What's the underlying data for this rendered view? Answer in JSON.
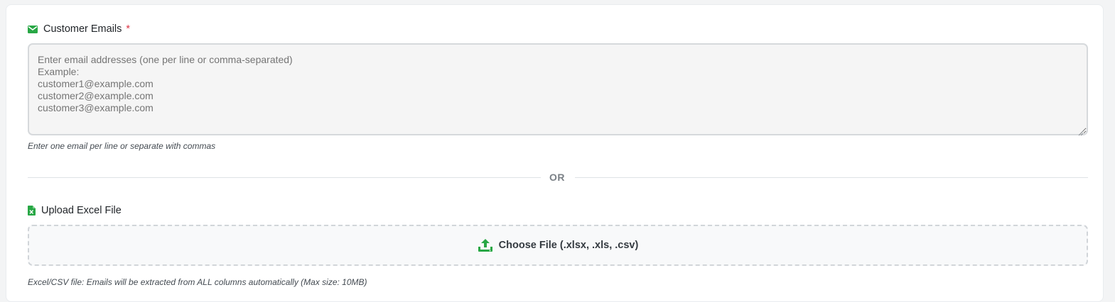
{
  "emails_section": {
    "label": "Customer Emails",
    "required_marker": "*",
    "placeholder": "Enter email addresses (one per line or comma-separated)\nExample:\ncustomer1@example.com\ncustomer2@example.com\ncustomer3@example.com",
    "help_text": "Enter one email per line or separate with commas",
    "icon": "envelope-icon"
  },
  "divider": {
    "text": "OR"
  },
  "upload_section": {
    "label": "Upload Excel File",
    "icon": "excel-file-icon",
    "button_label": "Choose File (.xlsx, .xls, .csv)",
    "button_icon": "upload-icon",
    "help_text": "Excel/CSV file: Emails will be extracted from ALL columns automatically (Max size: 10MB)"
  },
  "colors": {
    "accent_green": "#28a745",
    "required_red": "#dc3545"
  }
}
